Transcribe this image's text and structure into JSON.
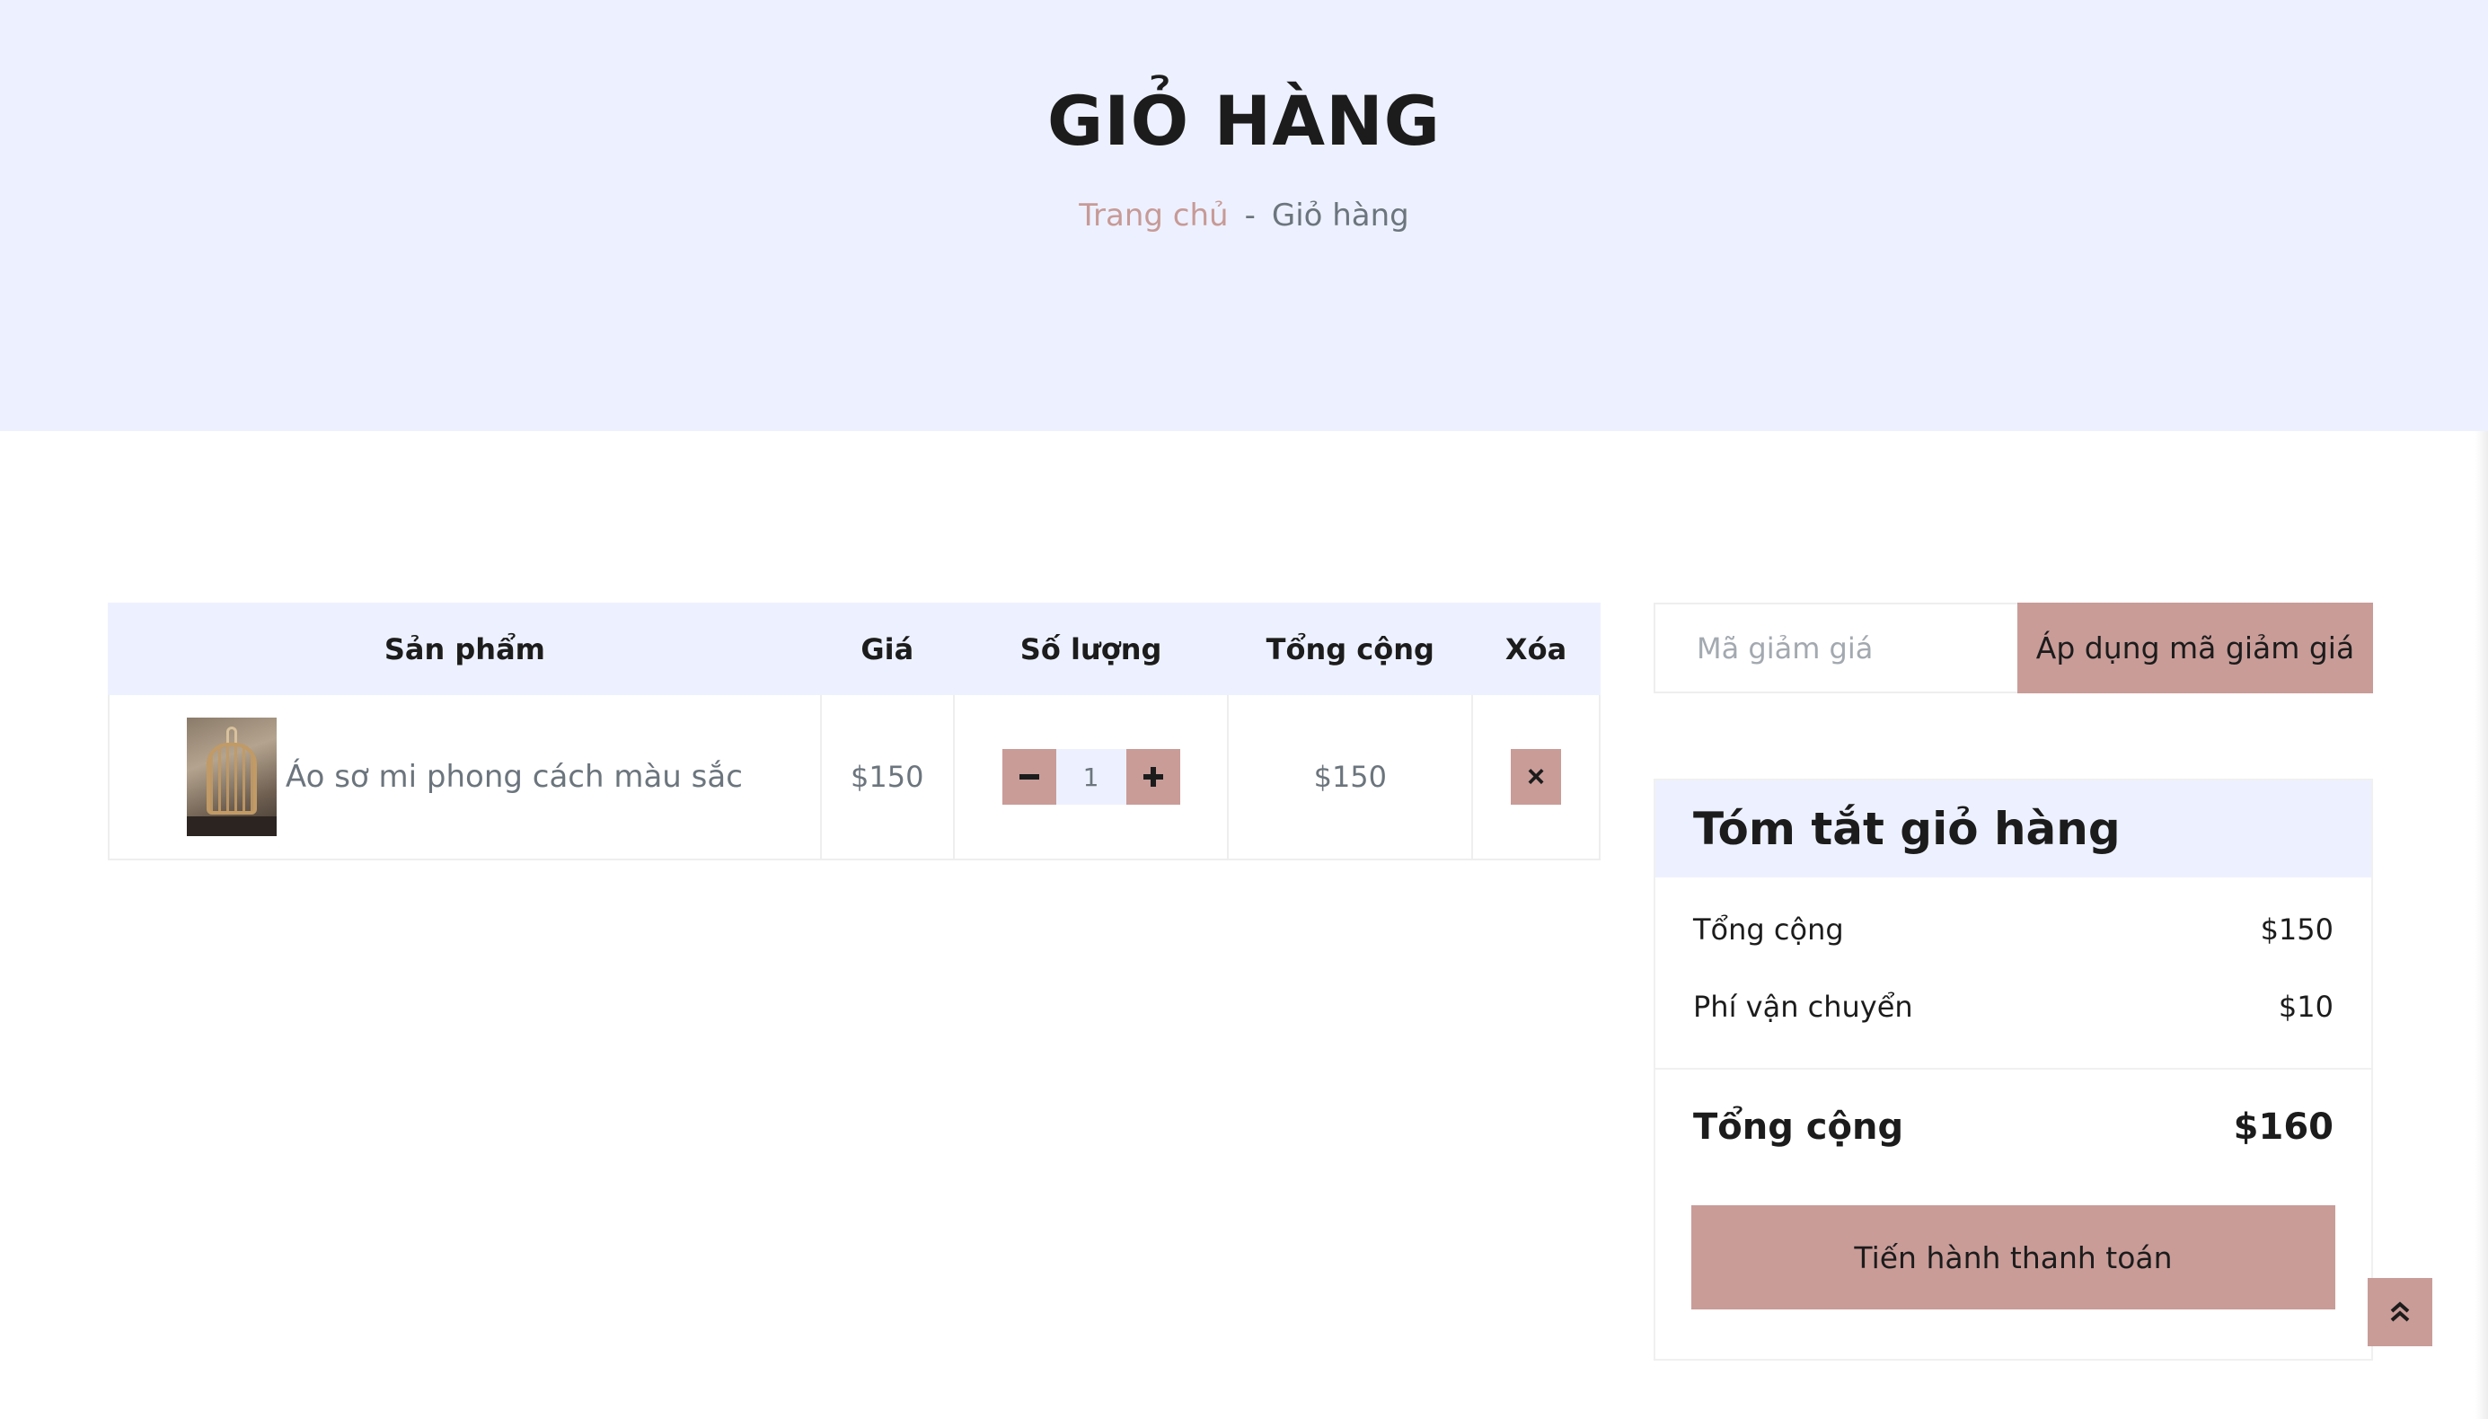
{
  "header": {
    "title": "GIỎ HÀNG",
    "breadcrumb": {
      "home": "Trang chủ",
      "separator": "-",
      "current": "Giỏ hàng"
    }
  },
  "cart": {
    "columns": [
      "Sản phẩm",
      "Giá",
      "Số lượng",
      "Tổng cộng",
      "Xóa"
    ],
    "items": [
      {
        "name": "Áo sơ mi phong cách màu sắc",
        "price": "$150",
        "quantity": "1",
        "total": "$150",
        "remove_label": "×"
      }
    ]
  },
  "coupon": {
    "placeholder": "Mã giảm giá",
    "button_label": "Áp dụng mã giảm giá"
  },
  "summary": {
    "title": "Tóm tắt giỏ hàng",
    "subtotal_label": "Tổng cộng",
    "subtotal_value": "$150",
    "shipping_label": "Phí vận chuyển",
    "shipping_value": "$10",
    "total_label": "Tổng cộng",
    "total_value": "$160",
    "checkout_label": "Tiến hành thanh toán"
  },
  "icons": {
    "minus": "minus-icon",
    "plus": "plus-icon",
    "remove": "close-icon",
    "back_to_top": "double-chevron-up-icon"
  },
  "colors": {
    "header_bg": "#edf1ff",
    "accent": "#c99c98",
    "breadcrumb_home": "#c79a97",
    "text_dark": "#1c1c1c",
    "text_muted": "#6c757d"
  }
}
